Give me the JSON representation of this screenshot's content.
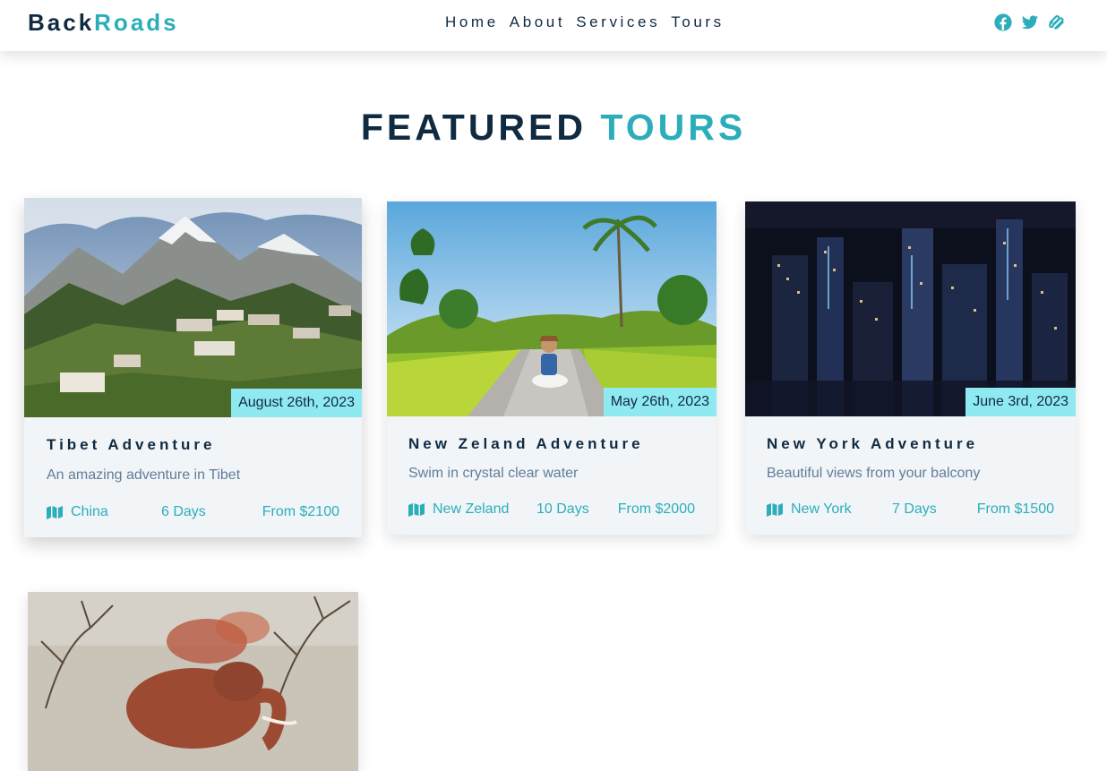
{
  "brand": {
    "part1": "Back",
    "part2": "Roads"
  },
  "nav": {
    "links": [
      "Home",
      "About",
      "Services",
      "Tours"
    ],
    "icons": [
      "facebook-icon",
      "twitter-icon",
      "squarespace-icon"
    ]
  },
  "section": {
    "title_part1": "FEATURED",
    "title_part2": "TOURS"
  },
  "colors": {
    "primary": "#2caeba",
    "badge": "#8fe9f1",
    "dark": "#102a42",
    "card_bg": "#f1f5f8",
    "text_muted": "#617d98"
  },
  "tours": [
    {
      "date": "August 26th, 2023",
      "title": "Tibet Adventure",
      "description": "An amazing adventure in Tibet",
      "location": "China",
      "days": "6 Days",
      "price": "From $2100",
      "image": "mountain-village-photo"
    },
    {
      "date": "May 26th, 2023",
      "title": "New Zeland Adventure",
      "description": "Swim in crystal clear water",
      "location": "New Zeland",
      "days": "10 Days",
      "price": "From $2000",
      "image": "woman-on-tropical-road-photo"
    },
    {
      "date": "June 3rd, 2023",
      "title": "New York Adventure",
      "description": "Beautiful views from your balcony",
      "location": "New York",
      "days": "7 Days",
      "price": "From $1500",
      "image": "city-skyline-night-photo"
    },
    {
      "image": "elephant-dust-photo"
    }
  ]
}
